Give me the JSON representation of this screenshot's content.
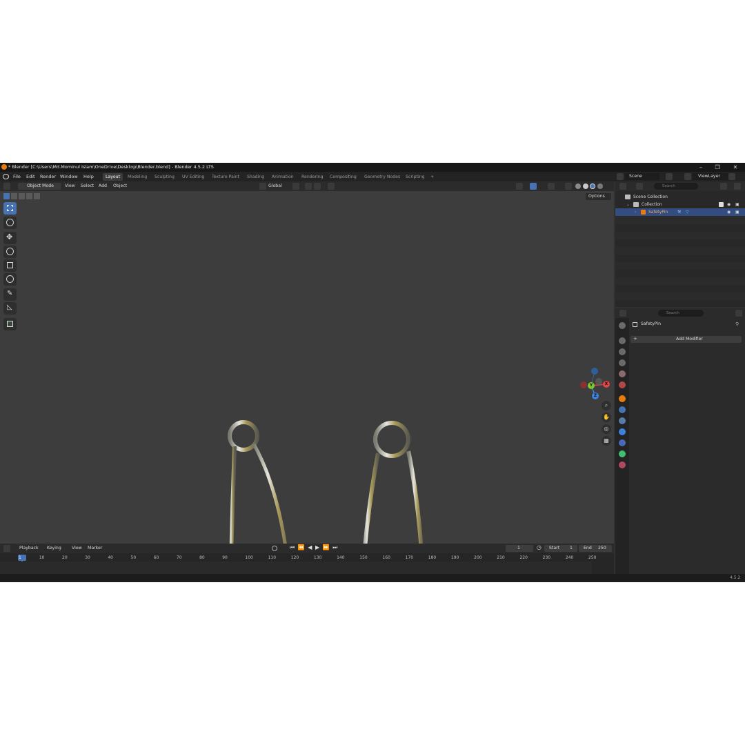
{
  "window": {
    "title": "* Blender [C:\\Users\\Md.Mominul Islam\\OneDrive\\Desktop\\Blender.blend] - Blender 4.5.2 LTS",
    "minimize": "–",
    "maximize": "❐",
    "close": "✕"
  },
  "menu": [
    "File",
    "Edit",
    "Render",
    "Window",
    "Help"
  ],
  "workspaces": [
    "Layout",
    "Modeling",
    "Sculpting",
    "UV Editing",
    "Texture Paint",
    "Shading",
    "Animation",
    "Rendering",
    "Compositing",
    "Geometry Nodes",
    "Scripting"
  ],
  "workspace_add": "+",
  "viewport_header": {
    "mode": "Object Mode",
    "menus": [
      "View",
      "Select",
      "Add",
      "Object"
    ],
    "orientation": "Global",
    "options": "Options"
  },
  "scene": {
    "label": "Scene",
    "view_layer": "ViewLayer"
  },
  "outliner": {
    "search_placeholder": "Search",
    "scene_collection": "Scene Collection",
    "collection": "Collection",
    "object": "SafetyPin"
  },
  "properties": {
    "search_placeholder": "Search",
    "object_name": "SafetyPin",
    "add_modifier": "Add Modifier"
  },
  "gizmo": {
    "x": "X",
    "y": "Y",
    "z": "Z"
  },
  "timeline": {
    "menus": [
      "Playback",
      "Keying",
      "View",
      "Marker"
    ],
    "current_frame": "1",
    "start_label": "Start",
    "start": "1",
    "end_label": "End",
    "end": "250",
    "ticks": [
      "1",
      "10",
      "20",
      "30",
      "40",
      "50",
      "60",
      "70",
      "80",
      "90",
      "100",
      "110",
      "120",
      "130",
      "140",
      "150",
      "160",
      "170",
      "180",
      "190",
      "200",
      "210",
      "220",
      "230",
      "240",
      "250"
    ]
  },
  "status": {
    "version": "4.5.2"
  },
  "colors": {
    "accent": "#4772b3",
    "selection": "#334d80",
    "x_axis": "#e54545",
    "y_axis": "#7ec82d",
    "z_axis": "#3d82dc"
  }
}
